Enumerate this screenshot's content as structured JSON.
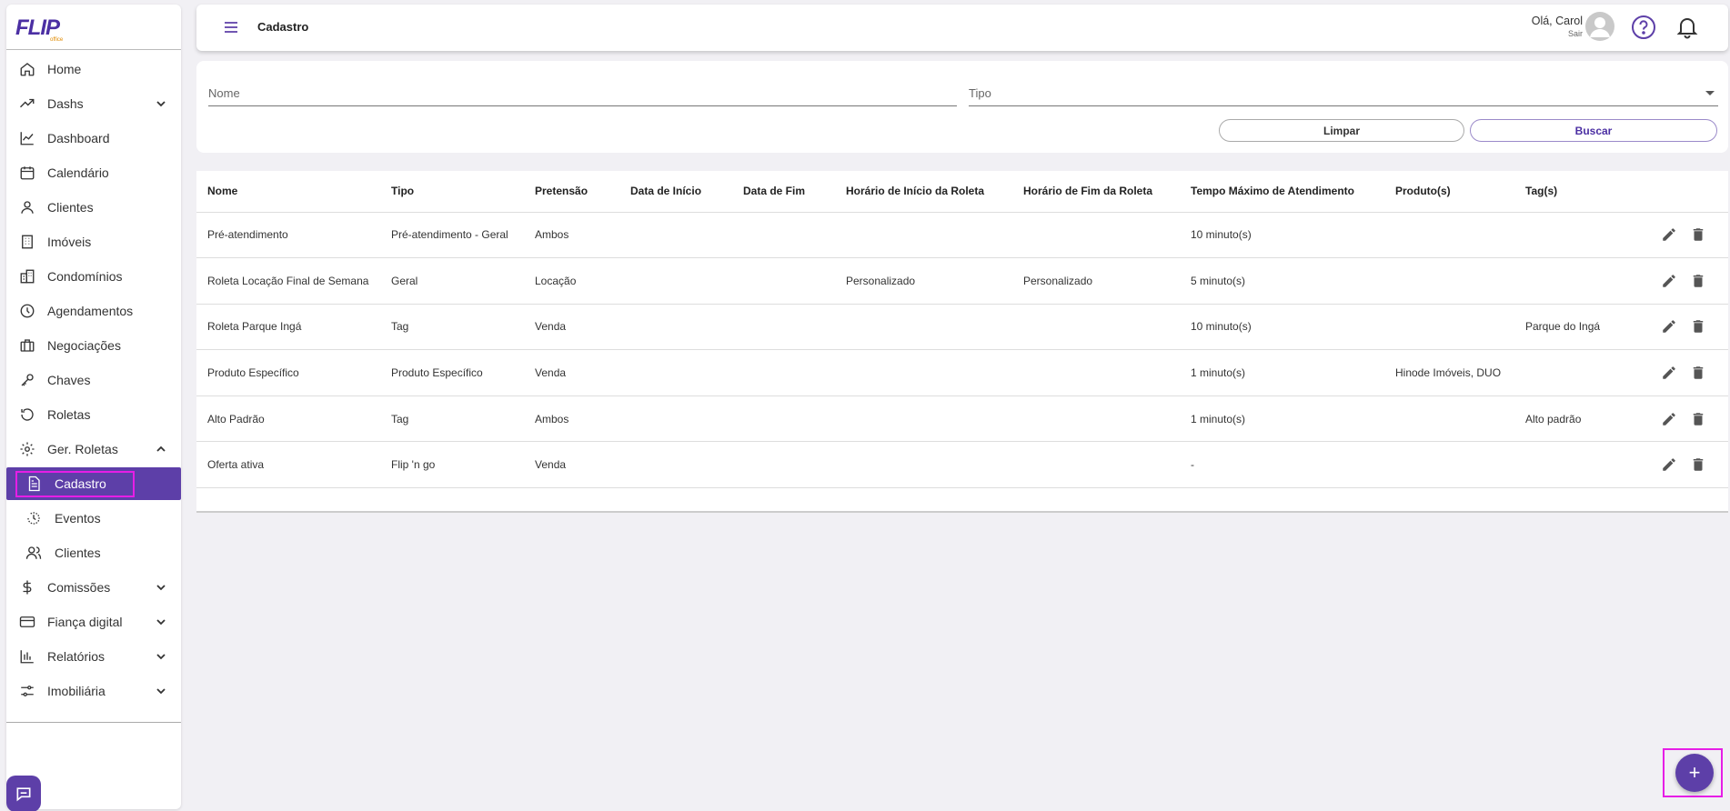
{
  "brand": {
    "logo": "FLIP",
    "logo_sub": "office",
    "accent": "#5d3fa8",
    "highlight": "#e61ee6"
  },
  "sidebar": {
    "items": [
      {
        "label": "Home",
        "icon": "home-icon"
      },
      {
        "label": "Dashs",
        "icon": "trending-up-icon",
        "expand": "chevron-down-icon"
      },
      {
        "label": "Dashboard",
        "icon": "line-chart-icon"
      },
      {
        "label": "Calendário",
        "icon": "calendar-icon"
      },
      {
        "label": "Clientes",
        "icon": "user-icon"
      },
      {
        "label": "Imóveis",
        "icon": "building-icon"
      },
      {
        "label": "Condomínios",
        "icon": "buildings-icon"
      },
      {
        "label": "Agendamentos",
        "icon": "clock-icon"
      },
      {
        "label": "Negociações",
        "icon": "briefcase-icon"
      },
      {
        "label": "Chaves",
        "icon": "key-icon"
      },
      {
        "label": "Roletas",
        "icon": "history-icon"
      },
      {
        "label": "Ger. Roletas",
        "icon": "gear-icon",
        "expand": "chevron-up-icon"
      }
    ],
    "sub_items": [
      {
        "label": "Cadastro",
        "icon": "document-icon",
        "active": true
      },
      {
        "label": "Eventos",
        "icon": "history-icon"
      },
      {
        "label": "Clientes",
        "icon": "users-icon"
      }
    ],
    "bottom_items": [
      {
        "label": "Comissões",
        "icon": "dollar-icon",
        "expand": "chevron-down-icon"
      },
      {
        "label": "Fiança digital",
        "icon": "credit-card-icon",
        "expand": "chevron-down-icon"
      },
      {
        "label": "Relatórios",
        "icon": "bar-chart-icon",
        "expand": "chevron-down-icon"
      },
      {
        "label": "Imobiliária",
        "icon": "sliders-icon",
        "expand": "chevron-down-icon"
      }
    ]
  },
  "header": {
    "title": "Cadastro",
    "greeting": "Olá, Carol",
    "logout": "Sair"
  },
  "filters": {
    "name_placeholder": "Nome",
    "type_placeholder": "Tipo",
    "clear_label": "Limpar",
    "search_label": "Buscar"
  },
  "table": {
    "columns": [
      "Nome",
      "Tipo",
      "Pretensão",
      "Data de Início",
      "Data de Fim",
      "Horário de Início da Roleta",
      "Horário de Fim da Roleta",
      "Tempo Máximo de Atendimento",
      "Produto(s)",
      "Tag(s)",
      ""
    ],
    "rows": [
      [
        "Pré-atendimento",
        "Pré-atendimento - Geral",
        "Ambos",
        "",
        "",
        "",
        "",
        "10 minuto(s)",
        "",
        ""
      ],
      [
        "Roleta Locação Final de Semana",
        "Geral",
        "Locação",
        "",
        "",
        "Personalizado",
        "Personalizado",
        "5 minuto(s)",
        "",
        ""
      ],
      [
        "Roleta Parque Ingá",
        "Tag",
        "Venda",
        "",
        "",
        "",
        "",
        "10 minuto(s)",
        "",
        "Parque do Ingá"
      ],
      [
        "Produto Específico",
        "Produto Específico",
        "Venda",
        "",
        "",
        "",
        "",
        "1 minuto(s)",
        "Hinode Imóveis, DUO",
        ""
      ],
      [
        "Alto Padrão",
        "Tag",
        "Ambos",
        "",
        "",
        "",
        "",
        "1 minuto(s)",
        "",
        "Alto padrão"
      ],
      [
        "Oferta ativa",
        "Flip 'n go",
        "Venda",
        "",
        "",
        "",
        "",
        "-",
        "",
        ""
      ]
    ]
  },
  "fab": {
    "label": "+"
  }
}
